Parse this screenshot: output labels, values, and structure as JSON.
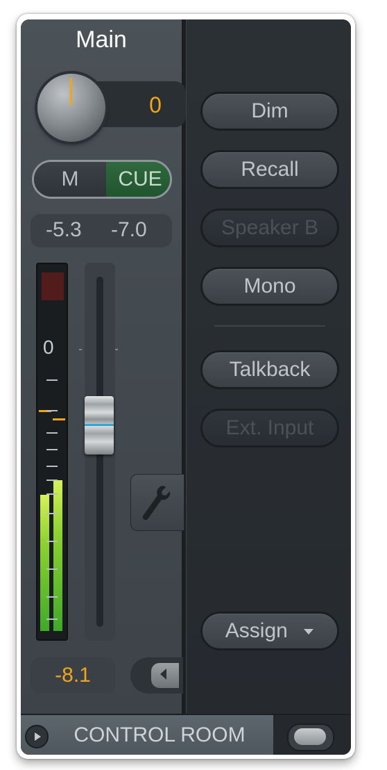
{
  "channel": {
    "title": "Main",
    "knob_value": "0",
    "mute_label": "M",
    "cue_label": "CUE",
    "level_left": "-5.3",
    "level_right": "-7.0",
    "meter_zero_label": "0",
    "fader_value": "-8.1"
  },
  "meter": {
    "left_level": 0.38,
    "right_level": 0.42
  },
  "right_panel": {
    "buttons": [
      {
        "label": "Dim",
        "enabled": true
      },
      {
        "label": "Recall",
        "enabled": true
      },
      {
        "label": "Speaker B",
        "enabled": false
      },
      {
        "label": "Mono",
        "enabled": true
      },
      {
        "label": "Talkback",
        "enabled": true
      },
      {
        "label": "Ext. Input",
        "enabled": false
      }
    ],
    "assign_label": "Assign"
  },
  "footer": {
    "label": "CONTROL ROOM"
  },
  "colors": {
    "accent": "#f2a51c",
    "cue_active": "#2f6a3c",
    "fader_line": "#2fa8d8"
  }
}
